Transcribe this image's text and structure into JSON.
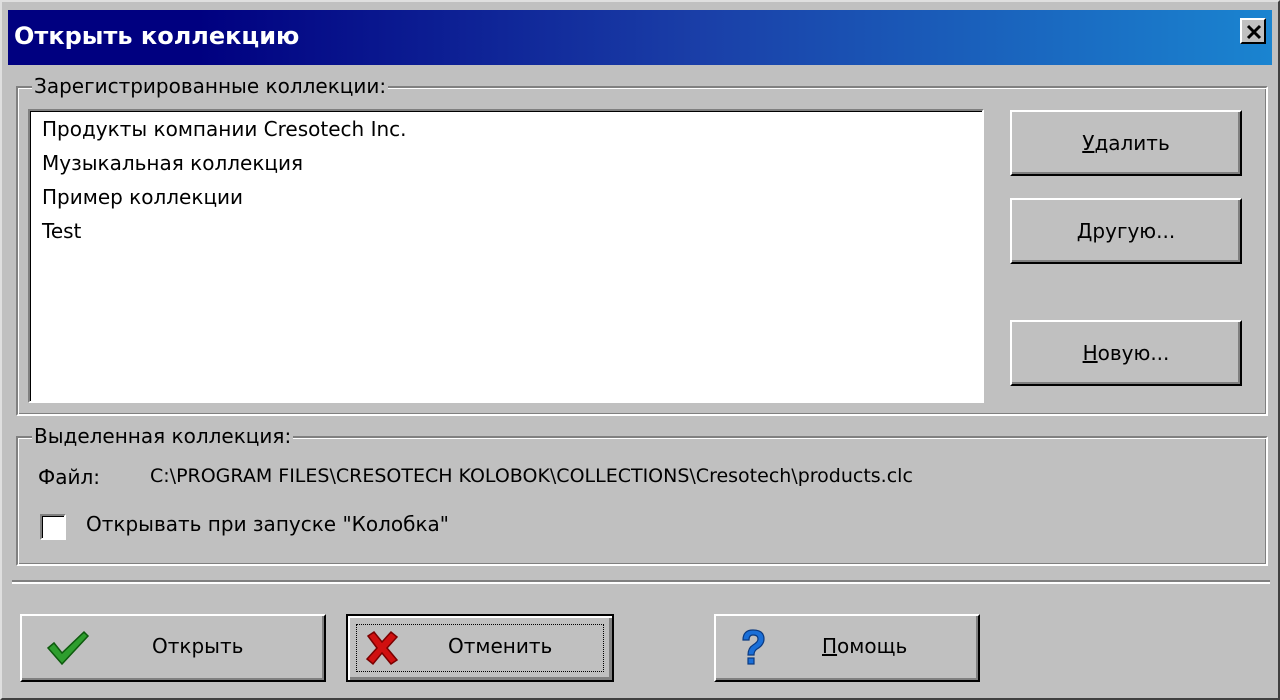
{
  "window": {
    "title": "Открыть коллекцию",
    "close_label": "×"
  },
  "registered": {
    "legend": "Зарегистрированные коллекции:",
    "items": [
      "Продукты компании Cresotech Inc.",
      "Музыкальная коллекция",
      "Пример коллекции",
      "Test"
    ]
  },
  "side_buttons": {
    "delete": {
      "accel": "У",
      "rest": "далить"
    },
    "other": {
      "accel": "Д",
      "rest": "ругую..."
    },
    "new": {
      "accel": "Н",
      "rest": "овую..."
    }
  },
  "selected": {
    "legend": "Выделенная коллекция:",
    "file_label": "Файл:",
    "file_path": "C:\\PROGRAM FILES\\CRESOTECH KOLOBOK\\COLLECTIONS\\Cresotech\\products.clc",
    "open_on_start_label": "Открывать при запуске \"Колобка\"",
    "open_on_start_checked": false
  },
  "bottom_buttons": {
    "open": "Открыть",
    "cancel": "Отменить",
    "help_accel": "П",
    "help_rest": "омощь"
  },
  "colors": {
    "face": "#c0c0c0",
    "title_start": "#000080",
    "title_end": "#1a84d0",
    "check_green": "#2e9e2e",
    "cross_red": "#d01010",
    "help_blue": "#1a6fd8"
  },
  "icons": {
    "open": "checkmark-icon",
    "cancel": "red-cross-icon",
    "help": "question-mark-icon"
  }
}
